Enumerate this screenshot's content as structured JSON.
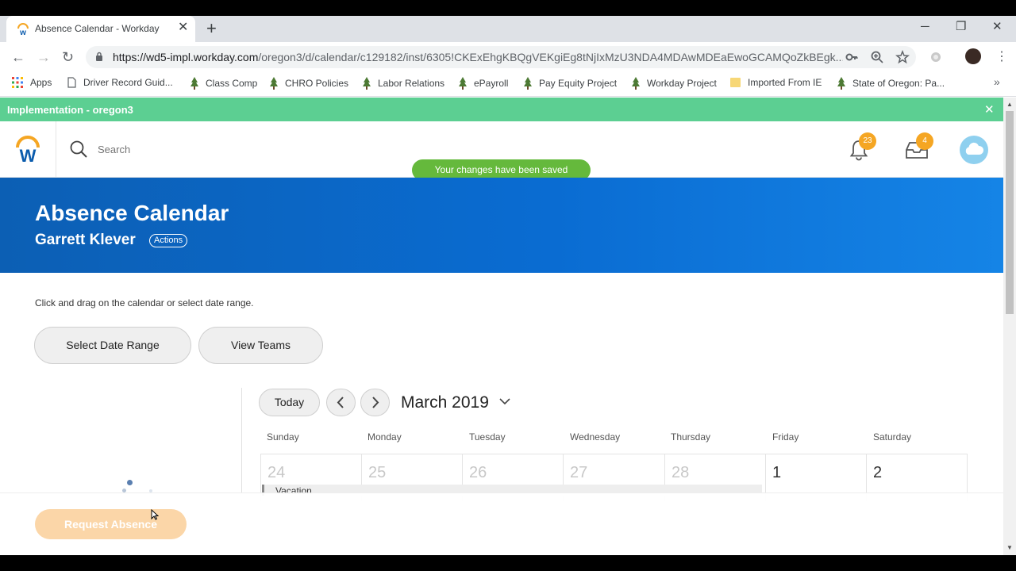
{
  "browser": {
    "tab_title": "Absence Calendar - Workday",
    "url_host": "https://wd5-impl.workday.com",
    "url_path": "/oregon3/d/calendar/c129182/inst/6305!CKExEhgKBQgVEKgiEg8tNjIxMzU3NDA4MDAwMDEaEwoGCAMQoZkBEgk...",
    "icons": {
      "back": "back-arrow-icon",
      "forward": "forward-arrow-icon",
      "reload": "reload-icon",
      "lock": "lock-icon",
      "key": "key-icon",
      "zoom": "zoom-icon",
      "star": "star-icon"
    },
    "bookmarks": [
      {
        "label": "Apps",
        "icon": "apps-grid-icon"
      },
      {
        "label": "Driver Record Guid...",
        "icon": "page-icon"
      },
      {
        "label": "Class Comp",
        "icon": "tree-icon"
      },
      {
        "label": "CHRO Policies",
        "icon": "tree-icon"
      },
      {
        "label": "Labor Relations",
        "icon": "tree-icon"
      },
      {
        "label": "ePayroll",
        "icon": "tree-icon"
      },
      {
        "label": "Pay Equity Project",
        "icon": "tree-icon"
      },
      {
        "label": "Workday Project",
        "icon": "tree-icon"
      },
      {
        "label": "Imported From IE",
        "icon": "folder-icon"
      },
      {
        "label": "State of Oregon: Pa...",
        "icon": "tree-icon"
      }
    ]
  },
  "workday": {
    "environment_banner": "Implementation - oregon3",
    "search_placeholder": "Search",
    "notifications_count": "23",
    "inbox_count": "4",
    "toast": "Your changes have been saved",
    "page_title": "Absence Calendar",
    "worker_name": "Garrett Klever",
    "actions_label": "Actions",
    "instruction": "Click and drag on the calendar or select date range.",
    "select_date_range": "Select Date Range",
    "view_teams": "View Teams",
    "request_absence": "Request Absence",
    "colors": {
      "banner": "#5ccf92",
      "toast": "#65b93c",
      "hero": "#0a6cd2",
      "badge": "#f5a623"
    }
  },
  "calendar": {
    "today_label": "Today",
    "month_label": "March 2019",
    "weekdays": [
      "Sunday",
      "Monday",
      "Tuesday",
      "Wednesday",
      "Thursday",
      "Friday",
      "Saturday"
    ],
    "first_week": [
      {
        "day": "24",
        "in_month": false
      },
      {
        "day": "25",
        "in_month": false
      },
      {
        "day": "26",
        "in_month": false
      },
      {
        "day": "27",
        "in_month": false
      },
      {
        "day": "28",
        "in_month": false
      },
      {
        "day": "1",
        "in_month": true
      },
      {
        "day": "2",
        "in_month": true
      }
    ],
    "event_label": "Vacation"
  }
}
